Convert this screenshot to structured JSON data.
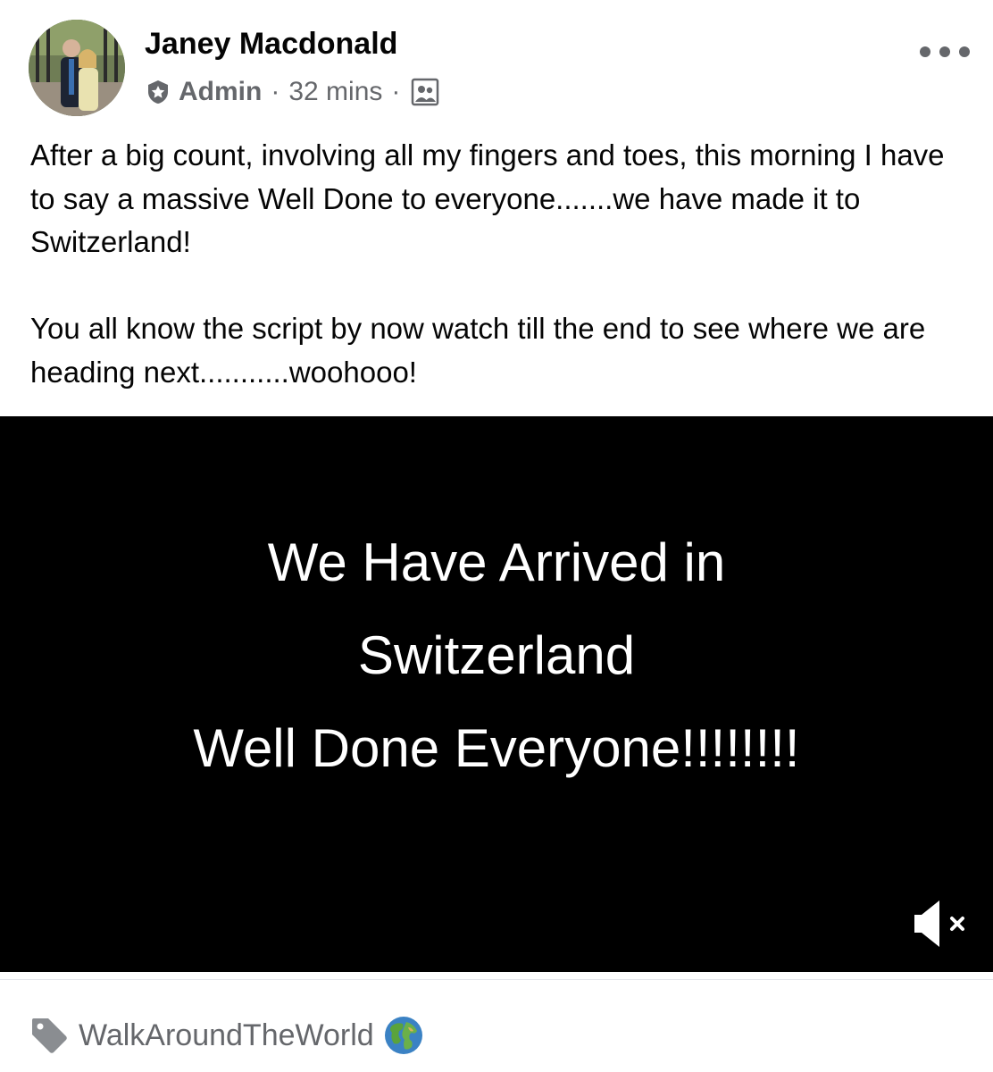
{
  "post": {
    "author": "Janey Macdonald",
    "role": "Admin",
    "separator": "·",
    "time": "32 mins",
    "audience_icon": "group-icon",
    "more_icon": "more-horizontal-icon",
    "paragraphs": [
      "After a big count, involving all my fingers and toes, this morning I have to say a massive Well Done to everyone.......we have made it to Switzerland!",
      "You all know the script by now watch till the end to see where we are heading next...........woohooo!"
    ]
  },
  "video": {
    "caption": "We Have Arrived in\nSwitzerland\nWell Done Everyone!!!!!!!!",
    "mute_icon": "speaker-muted-icon"
  },
  "tag": {
    "icon": "tag-icon",
    "label": "WalkAroundTheWorld",
    "emoji_icon": "globe-icon"
  },
  "colors": {
    "text": "#050505",
    "secondary": "#65676b",
    "video_bg": "#000000",
    "video_text": "#ffffff"
  }
}
